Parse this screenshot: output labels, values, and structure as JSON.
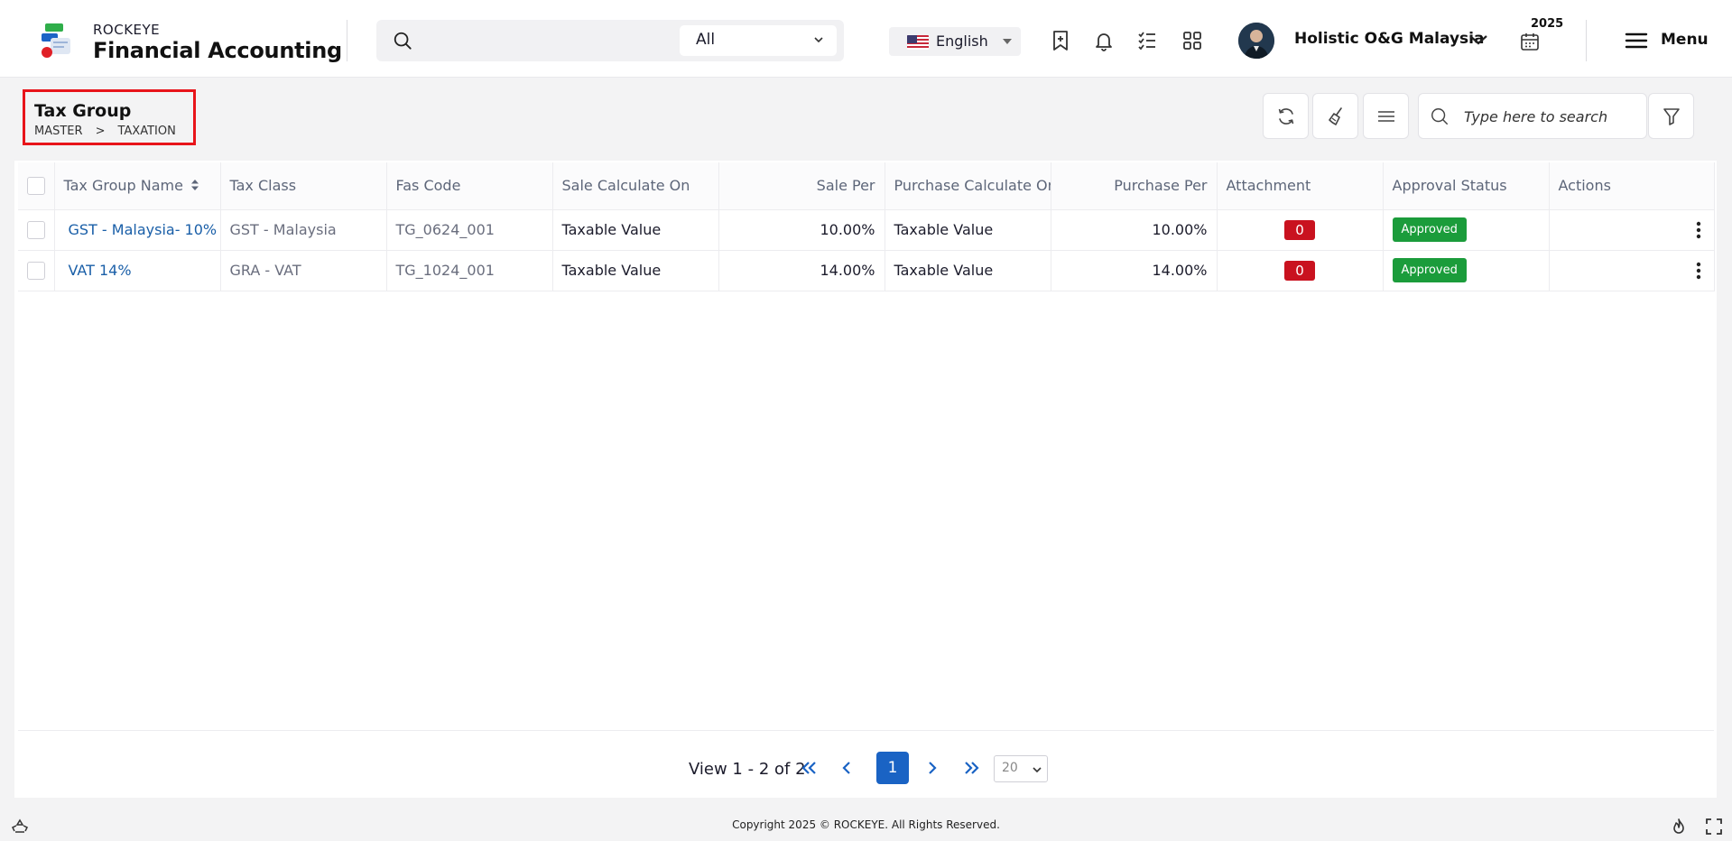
{
  "header": {
    "brand_small": "ROCKEYE",
    "brand_big": "Financial Accounting",
    "search_scope": "All",
    "language": "English",
    "company": "Holistic O&G Malaysia",
    "year": "2025",
    "menu_label": "Menu"
  },
  "page": {
    "title": "Tax Group",
    "breadcrumb": [
      "MASTER",
      ">",
      "TAXATION"
    ],
    "search_placeholder": "Type here to search"
  },
  "grid": {
    "columns": [
      "Tax Group Name",
      "Tax Class",
      "Fas Code",
      "Sale Calculate On",
      "Sale Per",
      "Purchase Calculate On",
      "Purchase Per",
      "Attachment",
      "Approval Status",
      "Actions"
    ],
    "rows": [
      {
        "name": "GST - Malaysia- 10%",
        "tax_class": "GST - Malaysia",
        "fas_code": "TG_0624_001",
        "sale_calc": "Taxable Value",
        "sale_per": "10.00%",
        "purchase_calc": "Taxable Value",
        "purchase_per": "10.00%",
        "attachment": "0",
        "status": "Approved"
      },
      {
        "name": "VAT 14%",
        "tax_class": "GRA - VAT",
        "fas_code": "TG_1024_001",
        "sale_calc": "Taxable Value",
        "sale_per": "14.00%",
        "purchase_calc": "Taxable Value",
        "purchase_per": "14.00%",
        "attachment": "0",
        "status": "Approved"
      }
    ]
  },
  "pager": {
    "summary": "View 1 - 2 of 2",
    "current_page": "1",
    "page_size": "20"
  },
  "footer": {
    "copyright": "Copyright 2025 © ROCKEYE. All Rights Reserved."
  },
  "colors": {
    "accent": "#1a63c4",
    "link": "#1a5fa8",
    "attachment_badge": "#c9121f",
    "approved_badge": "#1b9c3b",
    "title_highlight": "#e8141a"
  }
}
